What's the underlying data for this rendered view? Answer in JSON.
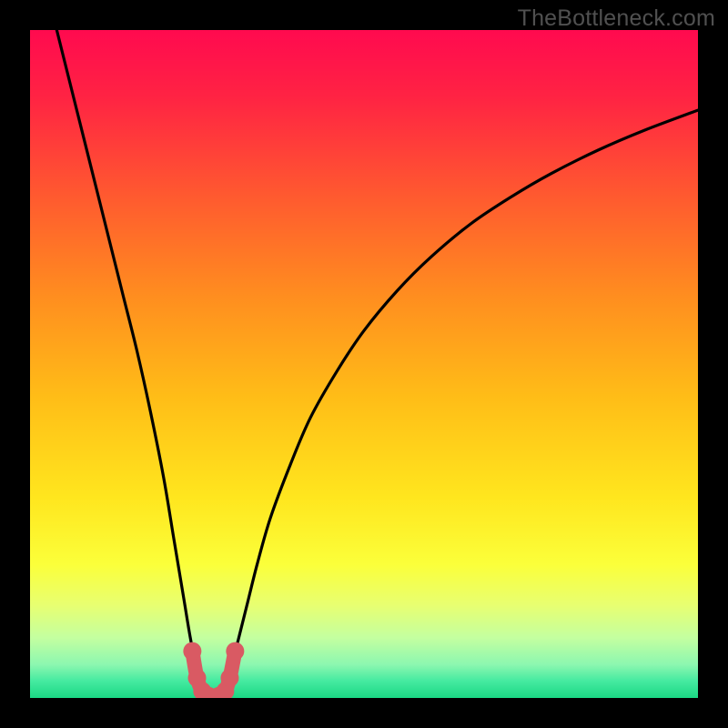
{
  "watermark": "TheBottleneck.com",
  "chart_data": {
    "type": "line",
    "title": "",
    "xlabel": "",
    "ylabel": "",
    "xlim": [
      0,
      100
    ],
    "ylim": [
      0,
      100
    ],
    "series": [
      {
        "name": "left-branch",
        "x": [
          4,
          6,
          8,
          10,
          12,
          14,
          16,
          18,
          20,
          21.5,
          23,
          24,
          25,
          25.8
        ],
        "y": [
          100,
          92,
          84,
          76,
          68,
          60,
          52,
          43,
          33,
          24,
          15,
          9,
          4,
          1
        ]
      },
      {
        "name": "right-branch",
        "x": [
          29.2,
          30,
          31,
          32.5,
          34,
          36,
          39,
          42,
          46,
          50,
          55,
          60,
          66,
          72,
          78,
          85,
          92,
          100
        ],
        "y": [
          1,
          4,
          8,
          14,
          20,
          27,
          35,
          42,
          49,
          55,
          61,
          66,
          71,
          75,
          78.5,
          82,
          85,
          88
        ]
      },
      {
        "name": "valley-highlight",
        "x": [
          24.3,
          25.0,
          25.8,
          26.7,
          27.5,
          28.3,
          29.2,
          29.9,
          30.7
        ],
        "y": [
          7.0,
          3.0,
          1.0,
          0.3,
          0.0,
          0.3,
          1.0,
          3.0,
          7.0
        ]
      }
    ],
    "gradient_stops": [
      {
        "offset": 0.0,
        "color": "#ff0a4f"
      },
      {
        "offset": 0.1,
        "color": "#ff2343"
      },
      {
        "offset": 0.25,
        "color": "#ff5a2f"
      },
      {
        "offset": 0.4,
        "color": "#ff8e1f"
      },
      {
        "offset": 0.55,
        "color": "#ffbd17"
      },
      {
        "offset": 0.7,
        "color": "#ffe61e"
      },
      {
        "offset": 0.8,
        "color": "#fbff3a"
      },
      {
        "offset": 0.86,
        "color": "#e8ff70"
      },
      {
        "offset": 0.91,
        "color": "#c4ffa0"
      },
      {
        "offset": 0.95,
        "color": "#8cf7b0"
      },
      {
        "offset": 0.975,
        "color": "#44eaa0"
      },
      {
        "offset": 1.0,
        "color": "#1bd884"
      }
    ],
    "highlight_color": "#d95a63",
    "curve_color": "#000000"
  }
}
